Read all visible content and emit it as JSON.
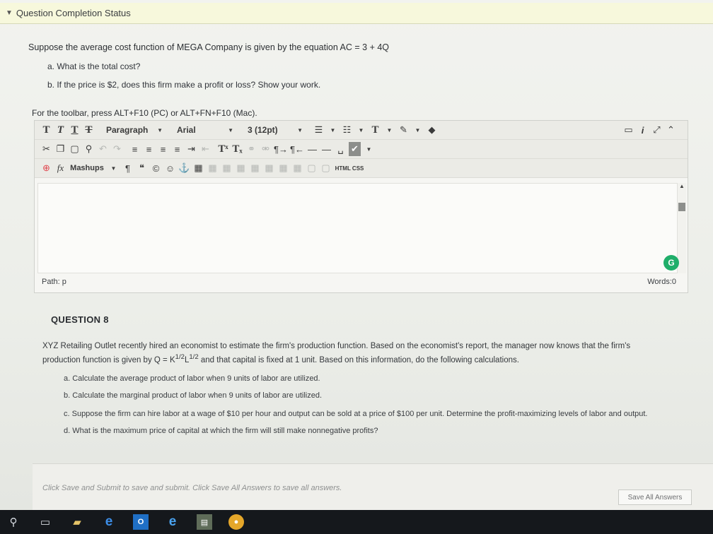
{
  "status_bar": {
    "title": "Question Completion Status"
  },
  "question7": {
    "prompt": "Suppose the average cost function of MEGA Company is given by the equation AC = 3 + 4Q",
    "items": [
      "a. What is the total cost?",
      "b. If the price is $2, does this firm make a profit or loss? Show your work."
    ]
  },
  "editor": {
    "toolbar_hint": "For the toolbar, press ALT+F10 (PC) or ALT+FN+F10 (Mac).",
    "paragraph_select": "Paragraph",
    "font_select": "Arial",
    "size_select": "3 (12pt)",
    "mashups_label": "Mashups",
    "html_css_label": "HTML CSS",
    "path_label": "Path: p",
    "words_label": "Words:0"
  },
  "question8": {
    "heading": "QUESTION 8",
    "body_line1": "XYZ Retailing Outlet recently hired an economist to estimate the firm's production function. Based on the economist's report, the manager now knows that the firm's",
    "body_line2_a": "production function is given by Q = K",
    "exp1": "1/2",
    "body_line2_b": "L",
    "exp2": "1/2",
    "body_line2_c": " and that capital is fixed at 1 unit. Based on this information, do the following calculations.",
    "items": [
      "a. Calculate the average product of labor when 9 units of labor are utilized.",
      "b. Calculate the marginal product of labor when 9 units of labor are utilized.",
      "c. Suppose the firm can hire labor at a wage of $10 per hour and output can be sold at a price of $100 per unit. Determine the profit-maximizing levels of labor and output.",
      "d. What is the maximum price of capital at which the firm will still make nonnegative profits?"
    ]
  },
  "footer": {
    "instruction": "Click Save and Submit to save and submit. Click Save All Answers to save all answers.",
    "save_all_label": "Save All Answers"
  },
  "icons": {
    "taskbar": [
      "search-icon",
      "task-view-icon",
      "file-explorer-icon",
      "edge-icon",
      "outlook-icon",
      "ie-icon",
      "app-icon",
      "chrome-icon"
    ]
  },
  "colors": {
    "status_bar_bg": "#f7f8dc",
    "grammar_badge": "#1fae6a",
    "taskbar_bg": "#15181c"
  }
}
